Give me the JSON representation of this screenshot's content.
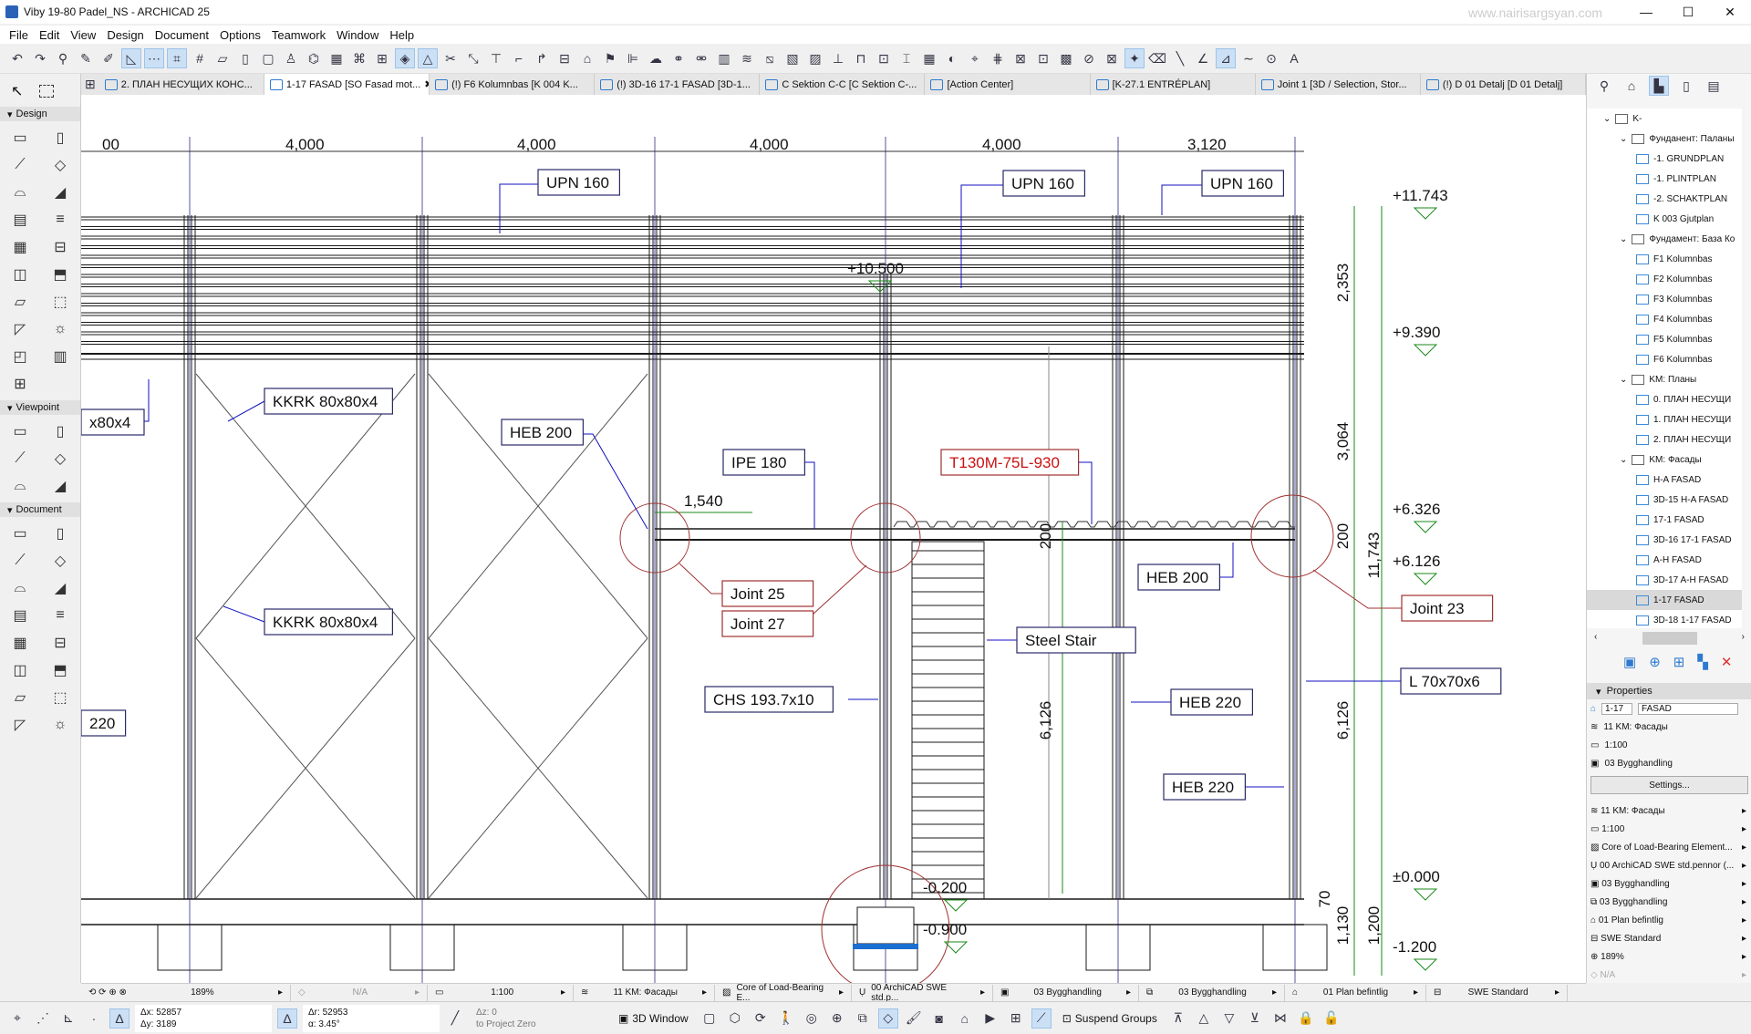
{
  "window": {
    "title": "Viby 19-80 Padel_NS - ARCHICAD 25",
    "watermark": "www.nairisargsyan.com",
    "controls": [
      "—",
      "☐",
      "✕"
    ]
  },
  "menu": [
    "File",
    "Edit",
    "View",
    "Design",
    "Document",
    "Options",
    "Teamwork",
    "Window",
    "Help"
  ],
  "toolbar": {
    "icons": [
      "undo-icon",
      "redo-icon",
      "find-select-icon",
      "pick-up-icon",
      "inject-icon",
      "guide-line-icon",
      "snap-icon",
      "coordinates-icon",
      "grid-icon",
      "plane-icon",
      "layer-icon",
      "view-icon",
      "figure-icon",
      "trace-icon",
      "measure-icon",
      "align-icon",
      "group-icon",
      "transform-icon",
      "orient-icon",
      "split-icon",
      "adjust-icon",
      "elevate-icon",
      "offset-icon",
      "fillet-icon",
      "resize-icon",
      "roof-icon",
      "flag-icon",
      "publish-icon",
      "teamwork-icon",
      "reserve-icon",
      "release-icon",
      "mesh-icon",
      "slab-icon",
      "stair-icon",
      "railing-icon",
      "beam-icon",
      "column-icon",
      "wall-icon",
      "curtain-icon",
      "morph-icon",
      "object-icon",
      "zone-icon",
      "window-icon",
      "door-icon",
      "skylight-icon",
      "lock-icon",
      "unlock-icon",
      "magic-wand-icon",
      "eraser-icon",
      "line-icon",
      "polyline-icon",
      "arc-icon",
      "spline-icon",
      "hotspot-icon",
      "text-icon",
      "label-icon",
      "dimension-icon"
    ]
  },
  "tabs": [
    {
      "label": "2. ПЛАН НЕСУЩИХ КОНС..."
    },
    {
      "label": "1-17 FASAD [SO Fasad mot...",
      "active": true
    },
    {
      "label": "(!) F6 Kolumnbas [K 004 K..."
    },
    {
      "label": "(!) 3D-16 17-1 FASAD [3D-1..."
    },
    {
      "label": "C Sektion C-C [C Sektion C-..."
    },
    {
      "label": "[Action Center]"
    },
    {
      "label": "[K-27.1 ENTRÉPLAN]"
    },
    {
      "label": "Joint 1 [3D / Selection, Stor..."
    },
    {
      "label": "(!) D 01 Detalj [D 01 Detalj]"
    }
  ],
  "toolbox": {
    "sections": [
      "Design",
      "Viewpoint",
      "Document"
    ]
  },
  "drawing": {
    "top_dims": [
      "00",
      "4,000",
      "4,000",
      "4,000",
      "4,000",
      "3,120"
    ],
    "labels": {
      "upn1": "UPN 160",
      "upn2": "UPN 160",
      "upn3": "UPN 160",
      "kkrk1": "KKRK 80x80x4",
      "kkrk2": "KKRK 80x80x4",
      "kkrk_partial": "x80x4",
      "heb200a": "HEB 200",
      "ipe180": "IPE 180",
      "t130": "T130M-75L-930",
      "joint25": "Joint 25",
      "joint27": "Joint 27",
      "joint23": "Joint 23",
      "heb200b": "HEB 200",
      "stair": "Steel Stair",
      "chs": "CHS 193.7x10",
      "heb220a": "HEB 220",
      "heb220b": "HEB 220",
      "l70": "L 70x70x6",
      "p220": "220",
      "d1540": "1,540"
    },
    "elevations": {
      "e1": "+11.743",
      "e2": "+10.500",
      "e3": "+9.390",
      "e4": "+6.326",
      "e5": "+6.126",
      "e6": "±0.000",
      "e7": "-0.200",
      "e8": "-0.900",
      "e9": "-1.200"
    },
    "vdims": {
      "v1": "2,353",
      "v2": "3,064",
      "v3": "200",
      "v4": "11,743",
      "v5": "6,126",
      "v6": "6,126",
      "v7": "200",
      "v8": "70",
      "v9": "1,130",
      "v10": "1,200"
    },
    "colors": {
      "line": "#1a1a1a",
      "label_border": "#2a2a6a",
      "joint": "#a03030",
      "leader": "#1010c0",
      "dim": "#1a8a1a",
      "red_text": "#cc1111"
    }
  },
  "navigator": {
    "items": [
      {
        "label": "K-",
        "type": "folder",
        "level": 0
      },
      {
        "label": "Фунданент: Паланы",
        "type": "folder",
        "level": 1
      },
      {
        "label": "-1. GRUNDPLAN",
        "type": "plan",
        "level": 2
      },
      {
        "label": "-1. PLINTPLAN",
        "type": "plan",
        "level": 2
      },
      {
        "label": "-2. SCHAKTPLAN",
        "type": "plan",
        "level": 2
      },
      {
        "label": "K 003 Gjutplan",
        "type": "detail",
        "level": 2
      },
      {
        "label": "Фундамент: База Ко",
        "type": "folder",
        "level": 1
      },
      {
        "label": "F1 Kolumnbas",
        "type": "detail",
        "level": 2
      },
      {
        "label": "F2 Kolumnbas",
        "type": "detail",
        "level": 2
      },
      {
        "label": "F3 Kolumnbas",
        "type": "detail",
        "level": 2
      },
      {
        "label": "F4 Kolumnbas",
        "type": "detail",
        "level": 2
      },
      {
        "label": "F5 Kolumnbas",
        "type": "detail",
        "level": 2
      },
      {
        "label": "F6 Kolumnbas",
        "type": "detail",
        "level": 2
      },
      {
        "label": "KM: Планы",
        "type": "folder",
        "level": 1
      },
      {
        "label": "0. ПЛАН НЕСУЩИ",
        "type": "plan",
        "level": 2
      },
      {
        "label": "1. ПЛАН НЕСУЩИ",
        "type": "plan",
        "level": 2
      },
      {
        "label": "2. ПЛАН НЕСУЩИ",
        "type": "plan",
        "level": 2
      },
      {
        "label": "KM: Фасады",
        "type": "folder",
        "level": 1
      },
      {
        "label": "H-A FASAD",
        "type": "elev",
        "level": 2
      },
      {
        "label": "3D-15 H-A FASAD",
        "type": "3d",
        "level": 2
      },
      {
        "label": "17-1  FASAD",
        "type": "elev",
        "level": 2
      },
      {
        "label": "3D-16 17-1 FASAD",
        "type": "3d",
        "level": 2
      },
      {
        "label": "A-H FASAD",
        "type": "elev",
        "level": 2
      },
      {
        "label": "3D-17 A-H FASAD",
        "type": "3d",
        "level": 2
      },
      {
        "label": "1-17 FASAD",
        "type": "elev",
        "level": 2,
        "selected": true
      },
      {
        "label": "3D-18 1-17 FASAD",
        "type": "3d",
        "level": 2
      }
    ]
  },
  "properties": {
    "title": "Properties",
    "id": "1-17",
    "name": "FASAD",
    "layer": "11 KM: Фасады",
    "scale": "1:100",
    "structure": "03 Bygghandling",
    "settings": "Settings...",
    "list": [
      "11 KM: Фасады",
      "1:100",
      "Core of Load-Bearing Element...",
      "00 ArchiCAD SWE std.pennor (...",
      "03 Bygghandling",
      "03 Bygghandling",
      "01 Plan befintlig",
      "SWE Standard",
      "189%",
      "N/A"
    ]
  },
  "status": {
    "zoom": "189%",
    "angle": "N/A",
    "scale": "1:100",
    "layer": "11 KM: Фасады",
    "structure": "Core of Load-Bearing E...",
    "pens": "00 ArchiCAD SWE std.p...",
    "model_view": "03 Bygghandling",
    "layer_combo": "03 Bygghandling",
    "renovation": "01 Plan befintlig",
    "dimension": "SWE Standard"
  },
  "coords": {
    "dx": "Δx: 52857",
    "dy": "Δy: 3189",
    "dr": "Δr: 52953",
    "a": "α: 3.45°",
    "dz": "Δz: 0",
    "ref": "to Project Zero"
  },
  "bottom": {
    "window3d": "3D Window",
    "suspend": "Suspend Groups"
  }
}
